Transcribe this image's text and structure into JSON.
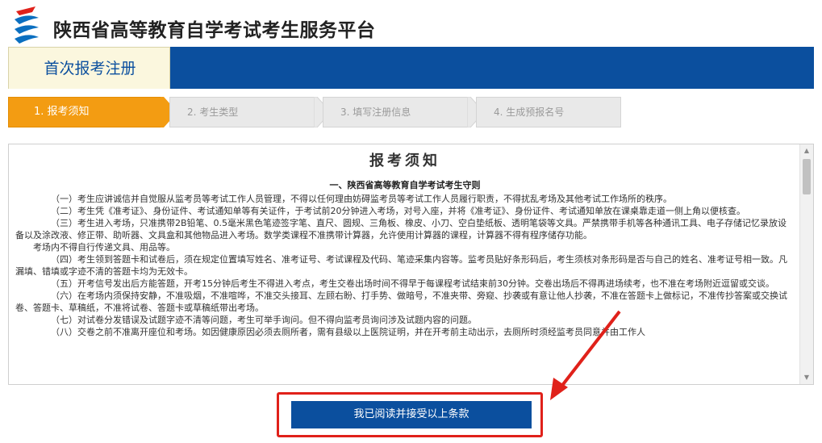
{
  "site": {
    "title": "陕西省高等教育自学考试考生服务平台",
    "logo_icon": "sxzk-logo-icon"
  },
  "registration": {
    "tab_label": "首次报考注册"
  },
  "steps": [
    {
      "label": "1. 报考须知",
      "active": true
    },
    {
      "label": "2. 考生类型",
      "active": false
    },
    {
      "label": "3. 填写注册信息",
      "active": false
    },
    {
      "label": "4. 生成预报名号",
      "active": false
    }
  ],
  "notice": {
    "title": "报考须知",
    "subtitle": "一、陕西省高等教育自学考试考生守则",
    "paragraphs": [
      "（一）考生应讲诚信并自觉服从监考员等考试工作人员管理，不得以任何理由妨碍监考员等考试工作人员履行职责，不得扰乱考场及其他考试工作场所的秩序。",
      "（二）考生凭《准考证》、身份证件、考试通知单等有关证件，于考试前20分钟进入考场，对号入座，并将《准考证》、身份证件、考试通知单放在课桌靠走道一侧上角以便核查。",
      "（三）考生进入考场，只准携带2B铅笔、0.5毫米黑色笔迹签字笔、直尺、圆规、三角板、橡皮、小刀、空白垫纸板、透明笔袋等文具。严禁携带手机等各种通讯工具、电子存储记忆录放设备以及涂改液、修正带、助听器、文具盒和其他物品进入考场。数学类课程不准携带计算器，允许使用计算器的课程，计算器不得有程序储存功能。",
      "考场内不得自行传递文具、用品等。",
      "（四）考生领到答题卡和试卷后，须在规定位置填写姓名、准考证号、考试课程及代码、笔迹采集内容等。监考员贴好条形码后，考生须核对条形码是否与自己的姓名、准考证号相一致。凡漏填、错填或字迹不清的答题卡均为无效卡。",
      "（五）开考信号发出后方能答题，开考15分钟后考生不得进入考点，考生交卷出场时间不得早于每课程考试结束前30分钟。交卷出场后不得再进场续考，也不准在考场附近逗留或交谈。",
      "（六）在考场内须保持安静，不准吸烟，不准喧哗，不准交头接耳、左顾右盼、打手势、做暗号，不准夹带、旁窥、抄袭或有意让他人抄袭，不准在答题卡上做标记，不准传抄答案或交换试卷、答题卡、草稿纸，不准将试卷、答题卡或草稿纸带出考场。",
      "（七）对试卷分发错误及试题字迹不清等问题，考生可举手询问。但不得向监考员询问涉及试题内容的问题。",
      "（八）交卷之前不准离开座位和考场。如因健康原因必须去厕所者，需有县级以上医院证明，并在开考前主动出示，去厕所时须经监考员同意并由工作人"
    ]
  },
  "accept_button": {
    "label": "我已阅读并接受以上条款"
  },
  "annotation": {
    "highlight_color": "#e0211a"
  },
  "colors": {
    "brand_blue": "#0b4f9e",
    "step_active": "#f39c12",
    "tab_bg": "#fbf7de"
  }
}
